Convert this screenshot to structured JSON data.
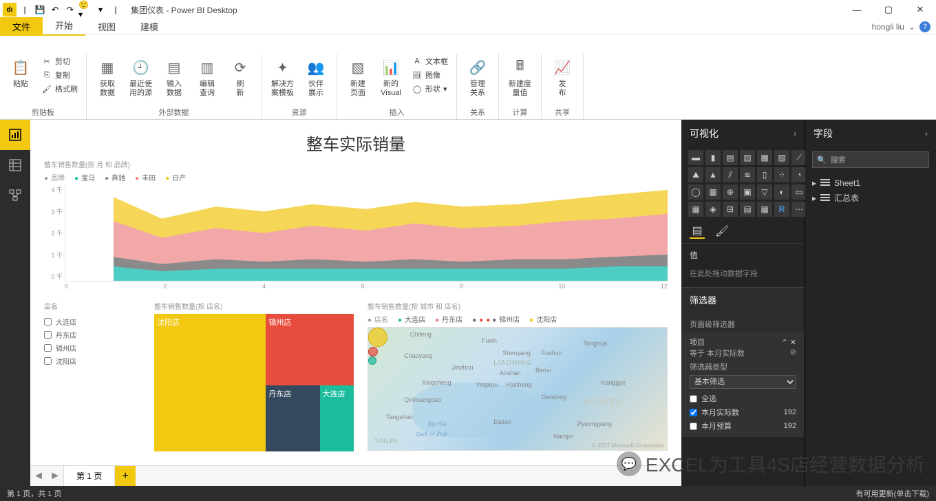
{
  "titlebar": {
    "title": "集团仪表 - Power BI Desktop"
  },
  "user": {
    "name": "hongli liu"
  },
  "ribbon": {
    "tabs": {
      "file": "文件",
      "home": "开始",
      "view": "视图",
      "model": "建模"
    },
    "clipboard": {
      "paste": "粘贴",
      "cut": "剪切",
      "copy": "复制",
      "format": "格式刷",
      "group": "剪贴板"
    },
    "external": {
      "getdata": "获取\n数据",
      "recent": "最近使\n用的源",
      "enter": "输入\n数据",
      "edit": "编辑\n查询",
      "refresh": "刷\n新",
      "group": "外部数据"
    },
    "resources": {
      "template": "解决方\n案模板",
      "partner": "伙伴\n展示",
      "group": "资源"
    },
    "insert": {
      "newpage": "新建\n页面",
      "newvisual": "新的\nVisual",
      "textbox": "文本框",
      "image": "图像",
      "shape": "形状",
      "group": "插入"
    },
    "relation": {
      "manage": "管理\n关系",
      "group": "关系"
    },
    "calc": {
      "measure": "新建度\n量值",
      "group": "计算"
    },
    "share": {
      "publish": "发\n布",
      "group": "共享"
    }
  },
  "canvas": {
    "title": "整车实际销量",
    "areachart": {
      "subtitle": "整车销售数量(按 月 和 品牌)",
      "legendlabel": "品牌",
      "series": [
        "宝马",
        "奔驰",
        "丰田",
        "日产"
      ],
      "ylabels": [
        "4 千",
        "3 千",
        "2 千",
        "1 千",
        "0 千"
      ],
      "xlabels": [
        "0",
        "2",
        "4",
        "6",
        "8",
        "10",
        "12"
      ]
    },
    "slicer": {
      "label": "店名",
      "items": [
        "大连店",
        "丹东店",
        "锦州店",
        "沈阳店"
      ]
    },
    "treemap": {
      "subtitle": "整车销售数量(按 店名)",
      "items": [
        "沈阳店",
        "锦州店",
        "丹东店",
        "大连店"
      ]
    },
    "map": {
      "subtitle": "整车销售数量(按 城市 和 店名)",
      "legendlabel": "店名",
      "series": [
        "大连店",
        "丹东店",
        "锦州店",
        "沈阳店"
      ],
      "attribution": "© 2017 Microsoft Corporation",
      "cities": [
        "Chifeng",
        "Chaoyang",
        "Fuxin",
        "Shenyang",
        "Fushun",
        "Tonghua",
        "LIAONING",
        "Jinzhou",
        "Anshan",
        "Benxi",
        "Xingcheng",
        "Yingkou",
        "Haicheng",
        "Kanggye",
        "Qinhuangdao",
        "Dandong",
        "NORTH",
        "Tangshan",
        "Dalian",
        "Pyeongyang",
        "Nampo",
        "Bo Hai",
        "Gulf of Zhili",
        "TIANJIN"
      ]
    }
  },
  "viz": {
    "header": "可视化",
    "value": "值",
    "drophere": "在此处拖动数据字段",
    "filters": "筛选器",
    "pagefilters": "页面级筛选器",
    "filteritem": {
      "name": "项目",
      "desc": "等于 本月实际数",
      "typelabel": "筛选器类型",
      "typevalue": "基本筛选",
      "all": "全选",
      "opt1": "本月实际数",
      "val1": "192",
      "opt2": "本月预算",
      "val2": "192"
    }
  },
  "fields": {
    "header": "字段",
    "search": "搜索",
    "tables": [
      "Sheet1",
      "汇总表"
    ]
  },
  "pagetabs": {
    "page1": "第 1 页"
  },
  "statusbar": {
    "left": "第 1 页，共 1 页",
    "right": "有可用更新(单击下载)"
  },
  "watermark": "EXCEL为工具4S店经营数据分析",
  "chart_data": [
    {
      "type": "area",
      "title": "整车销售数量(按 月 和 品牌)",
      "xlabel": "月",
      "ylabel": "整车销售数量",
      "x": [
        1,
        2,
        3,
        4,
        5,
        6,
        7,
        8,
        9,
        10,
        11,
        12
      ],
      "series": [
        {
          "name": "宝马",
          "color": "#1abc9c",
          "values": [
            400,
            350,
            380,
            360,
            390,
            370,
            380,
            360,
            370,
            380,
            400,
            420
          ]
        },
        {
          "name": "奔驰",
          "color": "#7f8c8d",
          "values": [
            450,
            380,
            420,
            400,
            430,
            410,
            420,
            400,
            410,
            420,
            440,
            480
          ]
        },
        {
          "name": "丰田",
          "color": "#f08080",
          "values": [
            1200,
            950,
            1100,
            1050,
            1150,
            1100,
            1200,
            1130,
            1160,
            1250,
            1300,
            1350
          ]
        },
        {
          "name": "日产",
          "color": "#f2c811",
          "values": [
            1000,
            820,
            900,
            850,
            920,
            880,
            900,
            870,
            900,
            960,
            1000,
            1050
          ]
        }
      ],
      "ylim": [
        0,
        4000
      ],
      "stacked": true
    },
    {
      "type": "treemap",
      "title": "整车销售数量(按 店名)",
      "categories": [
        "沈阳店",
        "锦州店",
        "丹东店",
        "大连店"
      ],
      "values": [
        56,
        22,
        14,
        8
      ]
    },
    {
      "type": "map",
      "title": "整车销售数量(按 城市 和 店名)",
      "points": [
        {
          "city": "沈阳",
          "store": "沈阳店",
          "size": 30
        },
        {
          "city": "锦州",
          "store": "锦州店",
          "size": 18
        },
        {
          "city": "大连",
          "store": "大连店",
          "size": 12
        },
        {
          "city": "丹东",
          "store": "丹东店",
          "size": 10
        }
      ]
    }
  ]
}
